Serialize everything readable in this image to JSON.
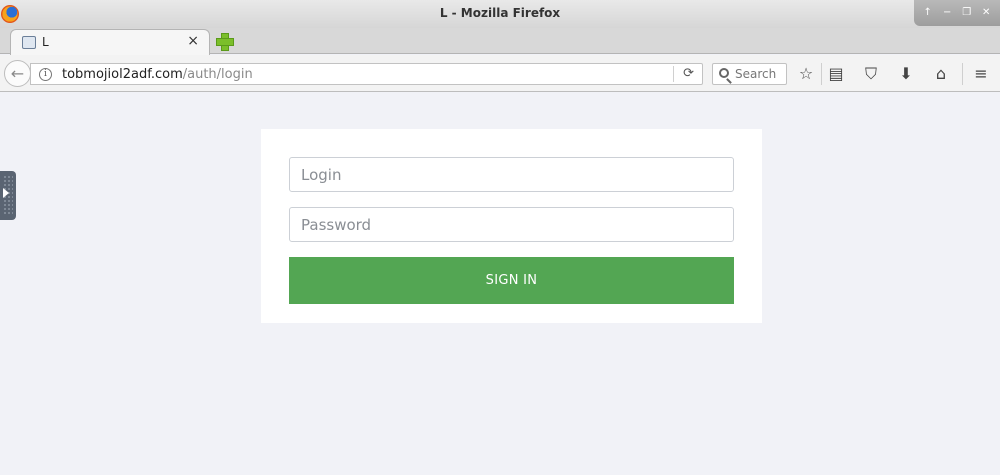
{
  "window": {
    "title": "L - Mozilla Firefox"
  },
  "tab": {
    "label": "L",
    "close": "×"
  },
  "navbar": {
    "url_host": "tobmojiol2adf.com",
    "url_path": "/auth/login",
    "search_placeholder": "Search"
  },
  "icons": {
    "back": "arrow-left-icon",
    "info": "info-icon",
    "reload": "reload-icon",
    "search": "search-icon",
    "bookmark": "star-icon",
    "library": "reading-list-icon",
    "pocket": "pocket-icon",
    "download": "download-icon",
    "home": "home-icon",
    "menu": "hamburger-menu-icon"
  },
  "login_form": {
    "login_placeholder": "Login",
    "password_placeholder": "Password",
    "submit_label": "SIGN IN"
  },
  "colors": {
    "page_bg": "#f1f2f7",
    "button_green": "#53a653"
  }
}
